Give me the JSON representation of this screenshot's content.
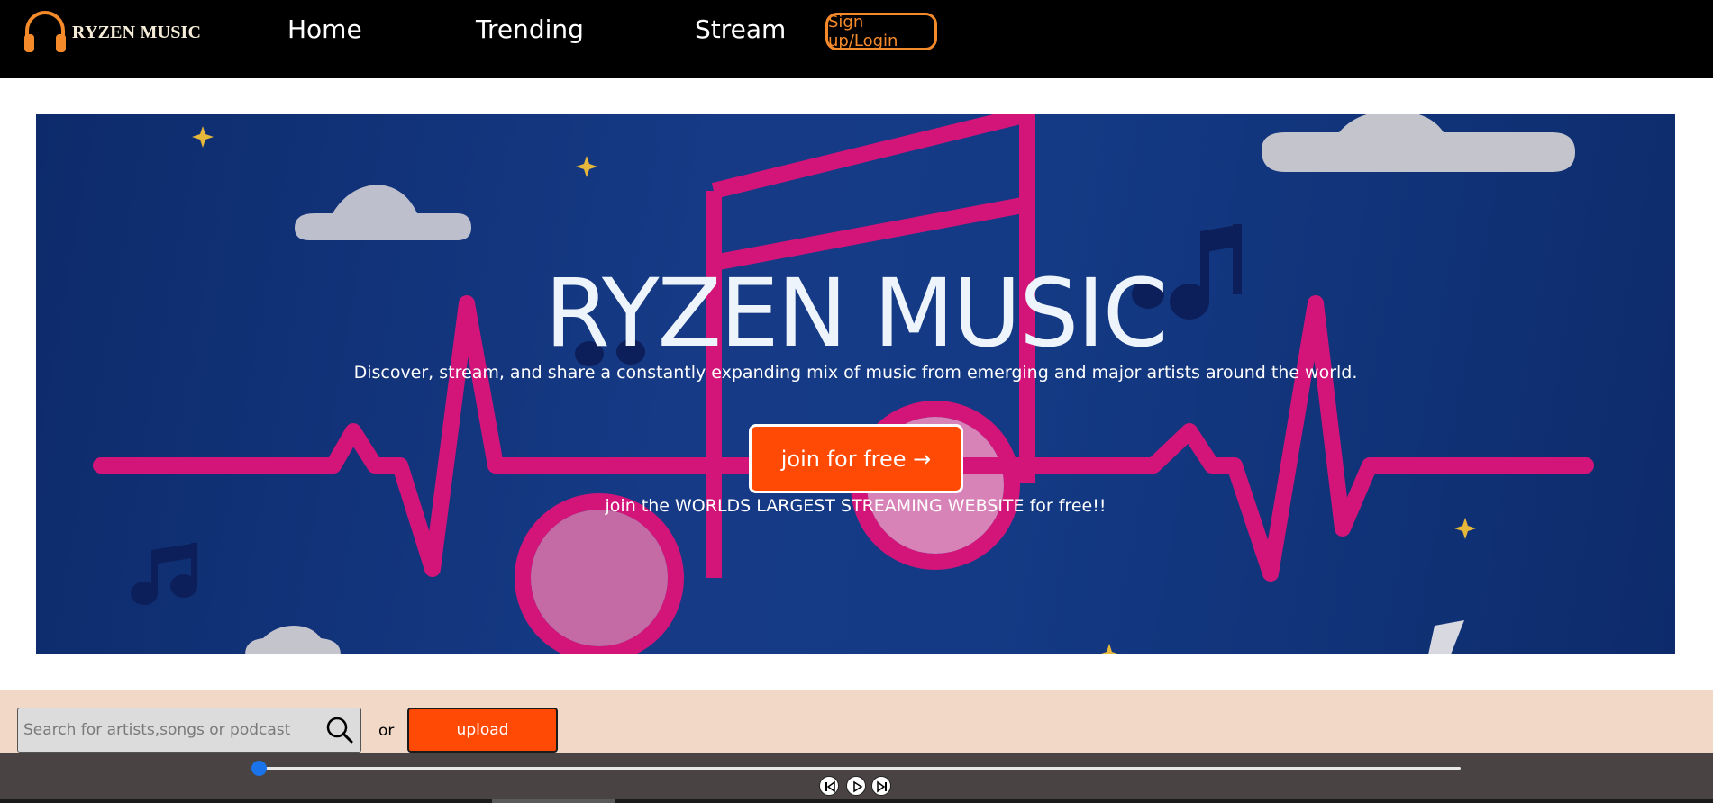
{
  "nav": {
    "logo_text": "RYZEN MUSIC",
    "links": [
      "Home",
      "Trending",
      "Stream"
    ],
    "signup_label": "Sign up/Login"
  },
  "hero": {
    "title": "RYZEN MUSIC",
    "subtitle": "Discover, stream, and share a constantly expanding mix of music from emerging and major artists around the world.",
    "cta_label": "join for free →",
    "note": "join the WORLDS LARGEST STREAMING WEBSITE for free!!"
  },
  "search": {
    "placeholder": "Search for artists,songs or podcast",
    "or_label": "or",
    "upload_label": "upload"
  },
  "player": {
    "progress": 0,
    "controls": [
      "previous-icon",
      "play-icon",
      "next-icon"
    ]
  },
  "colors": {
    "nav_bg": "#000000",
    "accent_orange": "#ff4a06",
    "signup_orange": "#f58a2b",
    "strip_bg": "#f2d9c7",
    "player_bg": "#4a4343",
    "hero_bg": "#143a85",
    "hero_pink": "#d3157a",
    "slider_blue": "#1a73e8"
  }
}
